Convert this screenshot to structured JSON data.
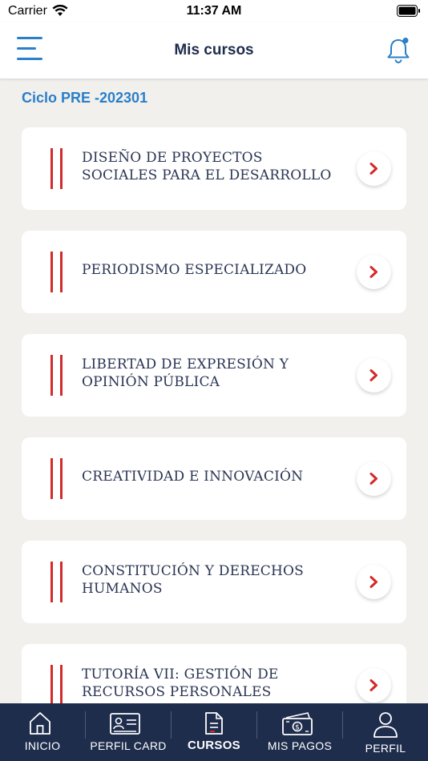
{
  "status": {
    "carrier": "Carrier",
    "time": "11:37 AM"
  },
  "header": {
    "title": "Mis cursos"
  },
  "cycle": "Ciclo PRE -202301",
  "courses": [
    {
      "lines": [
        "DISEÑO DE PROYECTOS",
        "SOCIALES PARA EL DESARROLLO"
      ]
    },
    {
      "lines": [
        "PERIODISMO ESPECIALIZADO"
      ]
    },
    {
      "lines": [
        "LIBERTAD DE EXPRESIÓN Y",
        "OPINIÓN PÚBLICA"
      ]
    },
    {
      "lines": [
        "CREATIVIDAD E INNOVACIÓN"
      ]
    },
    {
      "lines": [
        "CONSTITUCIÓN Y DERECHOS",
        "HUMANOS"
      ]
    },
    {
      "lines": [
        "TUTORÍA VII: GESTIÓN DE",
        "RECURSOS PERSONALES"
      ]
    }
  ],
  "tabs": [
    {
      "label": "INICIO",
      "icon": "home-icon"
    },
    {
      "label": "PERFIL CARD",
      "icon": "id-card-icon"
    },
    {
      "label": "CURSOS",
      "icon": "document-icon",
      "active": true
    },
    {
      "label": "MIS PAGOS",
      "icon": "money-icon"
    },
    {
      "label": "PERFIL",
      "icon": "user-icon"
    }
  ],
  "colors": {
    "accent_blue": "#2a7fc9",
    "accent_red": "#d42a2a",
    "navy": "#1f2d4d",
    "background": "#f2f0ec"
  }
}
